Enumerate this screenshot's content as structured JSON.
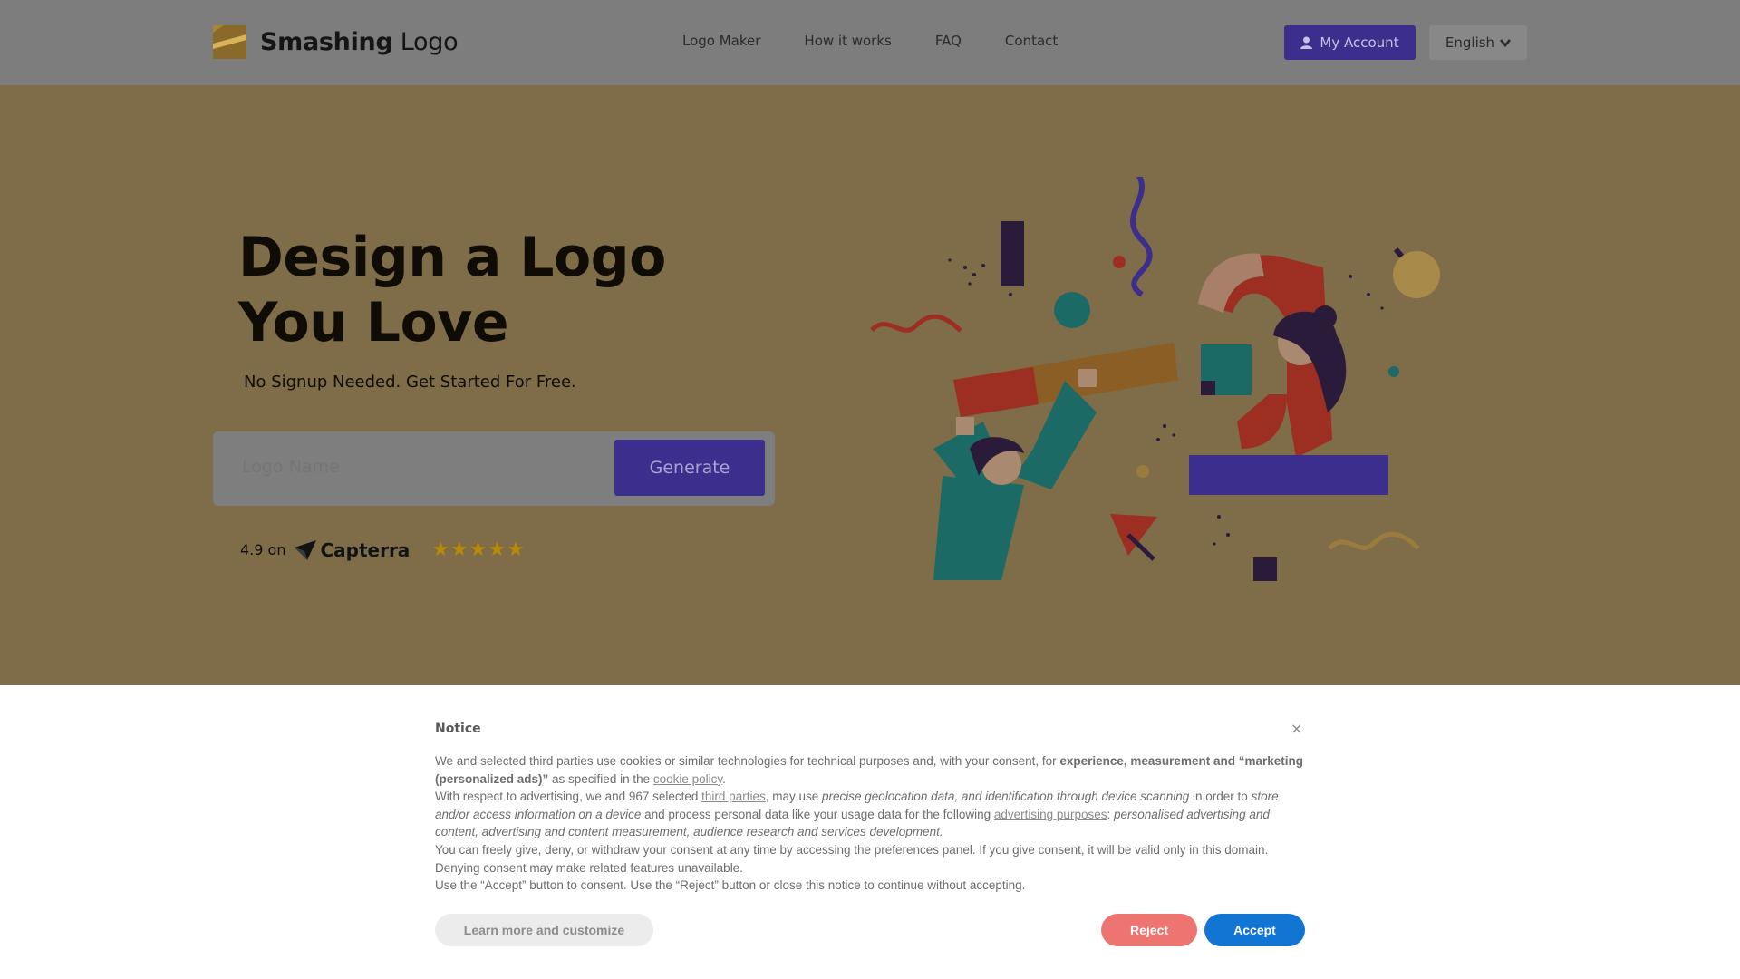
{
  "header": {
    "brand_bold": "Smashing",
    "brand_light": " Logo",
    "nav": [
      "Logo Maker",
      "How it works",
      "FAQ",
      "Contact"
    ],
    "account_label": "My Account",
    "language_label": "English"
  },
  "hero": {
    "title_line1": "Design a Logo",
    "title_line2": "You Love",
    "subtitle": "No Signup Needed. Get Started For Free.",
    "input_placeholder": "Logo Name",
    "generate_label": "Generate",
    "rating_text": "4.9 on",
    "rating_brand": "Capterra",
    "stars": "★★★★★"
  },
  "notice": {
    "title": "Notice",
    "close": "×",
    "p1_a": "We and selected third parties use cookies or similar technologies for technical purposes and, with your consent, for ",
    "p1_b": "experience, measurement and “marketing (personalized ads)”",
    "p1_c": " as specified in the ",
    "p1_link": "cookie policy",
    "p1_d": ".",
    "p2_a": "With respect to advertising, we and 967 selected ",
    "p2_link1": "third parties",
    "p2_b": ", may use ",
    "p2_c": "precise geolocation data, and identification through device scanning",
    "p2_d": " in order to ",
    "p2_e": "store and/or access information on a device",
    "p2_f": " and process personal data like your usage data for the following ",
    "p2_link2": "advertising purposes",
    "p2_g": ": ",
    "p2_h": "personalised advertising and content, advertising and content measurement, audience research and services development.",
    "p3": "You can freely give, deny, or withdraw your consent at any time by accessing the preferences panel. If you give consent, it will be valid only in this domain. Denying consent may make related features unavailable.",
    "p4": "Use the “Accept” button to consent. Use the “Reject” button or close this notice to continue without accepting.",
    "learn_label": "Learn more and customize",
    "reject_label": "Reject",
    "accept_label": "Accept"
  },
  "colors": {
    "brand_purple": "#3b2e8c",
    "accept_blue": "#1275d4",
    "reject_red": "#ee7471"
  }
}
